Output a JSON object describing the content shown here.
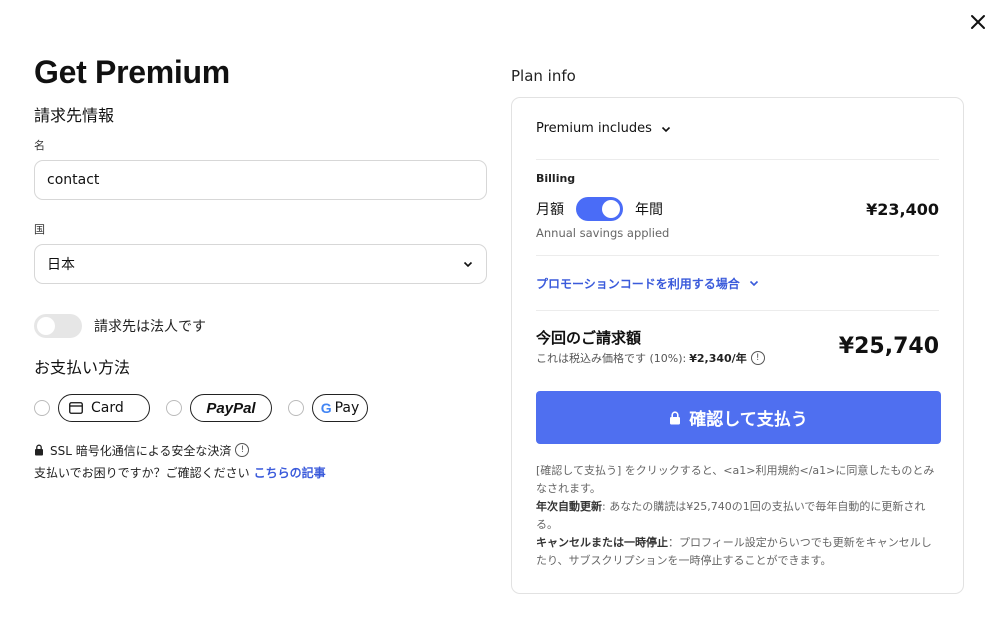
{
  "left": {
    "title": "Get Premium",
    "billing_info_heading": "請求先情報",
    "name_label": "名",
    "name_value": "contact",
    "country_label": "国",
    "country_value": "日本",
    "company_toggle_label": "請求先は法人です",
    "payment_method_heading": "お支払い方法",
    "payment_methods": {
      "card": "Card",
      "paypal": "PayPal",
      "gpay_g": "G",
      "gpay": "Pay"
    },
    "secure_text": "SSL 暗号化通信による安全な決済",
    "help_text": "支払いでお困りですか？ご確認ください",
    "help_link": "こちらの記事",
    "info_glyph": "!"
  },
  "right": {
    "heading": "Plan info",
    "includes_label": "Premium includes",
    "billing_label": "Billing",
    "monthly_label": "月額",
    "annual_label": "年間",
    "annual_toggle_on": true,
    "billing_price": "¥23,400",
    "savings_note": "Annual savings applied",
    "promo_label": "プロモーションコードを利用する場合",
    "total_label": "今回のご請求額",
    "tax_note_prefix": "これは税込み価格です (10%):",
    "tax_amount": "¥2,340/年",
    "total_amount": "¥25,740",
    "pay_button": "確認して支払う",
    "terms_line1": "[確認して支払う] をクリックすると、<a1>利用規約</a1>に同意したものとみなされます。",
    "auto_renew_label": "年次自動更新",
    "auto_renew_text": ": あなたの購読は¥25,740の1回の支払いで毎年自動的に更新される。",
    "cancel_label": "キャンセルまたは一時停止",
    "cancel_text": "：プロフィール設定からいつでも更新をキャンセルしたり、サブスクリプションを一時停止することができます。"
  },
  "colors": {
    "accent": "#4f6ff0",
    "link": "#3b5bdb"
  },
  "icons": [
    "close-icon",
    "chevron-down-icon",
    "credit-card-icon",
    "lock-icon",
    "info-icon"
  ]
}
